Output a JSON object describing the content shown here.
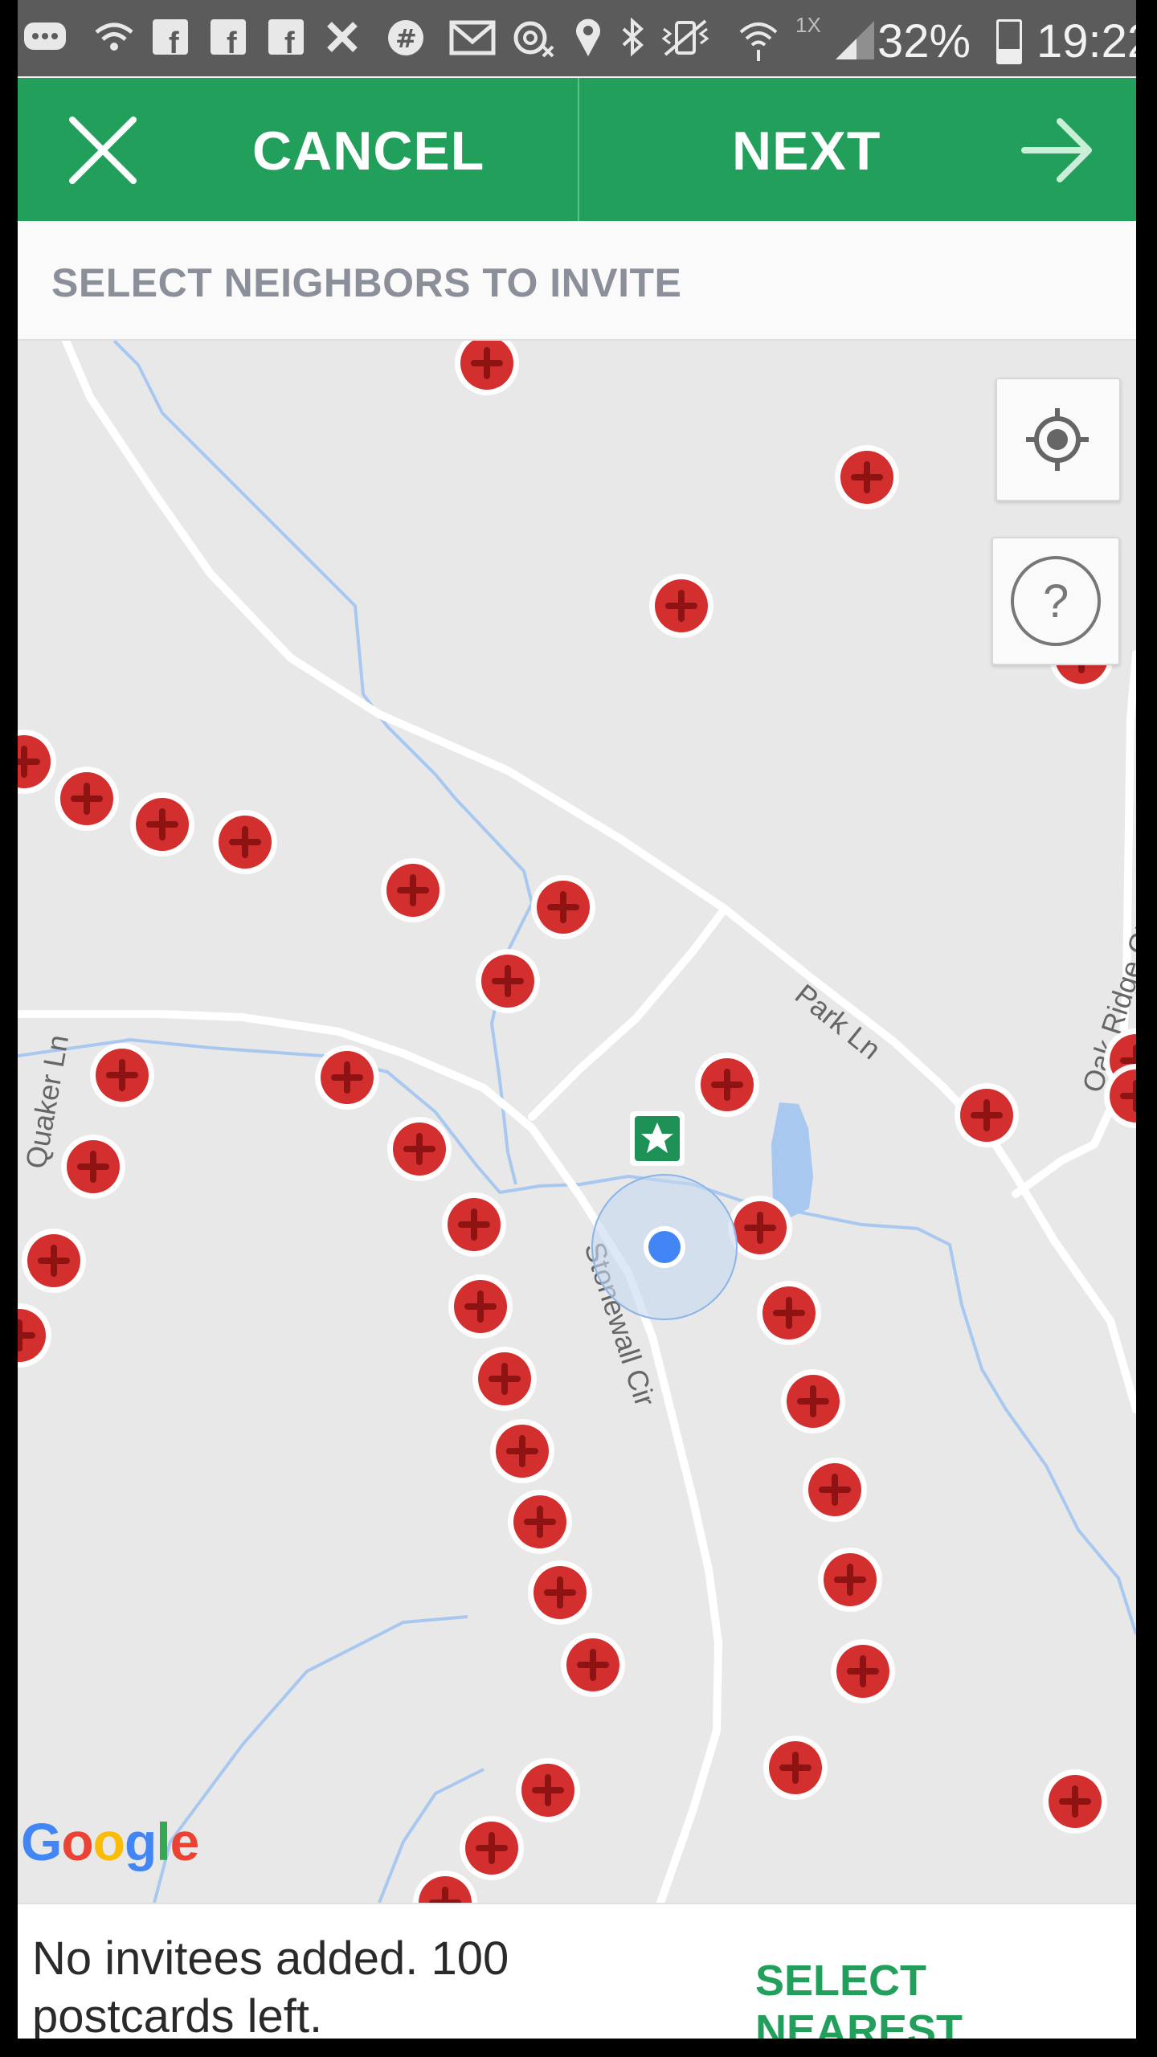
{
  "status_bar": {
    "icons": [
      "chat-icon",
      "wifi-icon",
      "facebook-icon",
      "facebook-icon",
      "facebook-icon",
      "tools-icon",
      "hashtag-icon",
      "mail-icon",
      "at-icon",
      "location-pin-icon",
      "bluetooth-icon",
      "vibrate-icon",
      "wifi-signal-icon",
      "cell-signal-icon"
    ],
    "speed": "1X",
    "battery": "32%",
    "time": "19:22"
  },
  "action_bar": {
    "cancel_label": "CANCEL",
    "next_label": "NEXT",
    "color": "#22a05b"
  },
  "header": {
    "title": "SELECT NEIGHBORS TO INVITE"
  },
  "map": {
    "road_labels": [
      "Park Ln",
      "Oak Ridge Ct",
      "Stonewall Cir",
      "Quaker Ln"
    ],
    "help_glyph": "?",
    "attribution": "Google",
    "marker_color": "#d32f2f"
  },
  "footer": {
    "status": "No invitees added. 100 postcards left.",
    "select_nearest_label": "SELECT NEAREST"
  }
}
